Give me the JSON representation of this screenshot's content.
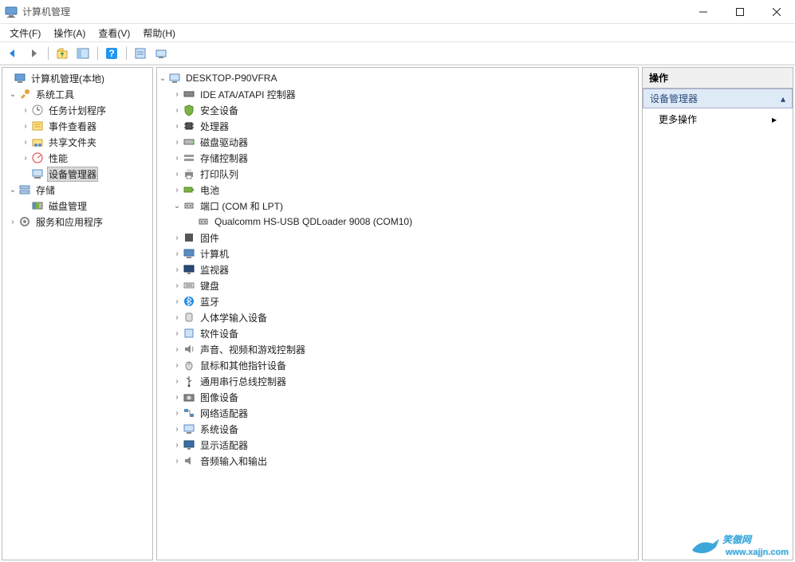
{
  "window": {
    "title": "计算机管理"
  },
  "menu": {
    "file": "文件(F)",
    "action": "操作(A)",
    "view": "查看(V)",
    "help": "帮助(H)"
  },
  "left_tree": {
    "root": "计算机管理(本地)",
    "system_tools": "系统工具",
    "task_scheduler": "任务计划程序",
    "event_viewer": "事件查看器",
    "shared_folders": "共享文件夹",
    "performance": "性能",
    "device_manager": "设备管理器",
    "storage": "存储",
    "disk_management": "磁盘管理",
    "services_apps": "服务和应用程序"
  },
  "center_tree": {
    "root": "DESKTOP-P90VFRA",
    "ide": "IDE ATA/ATAPI 控制器",
    "security": "安全设备",
    "cpu": "处理器",
    "disk_drives": "磁盘驱动器",
    "storage_ctrl": "存储控制器",
    "print_queue": "打印队列",
    "battery": "电池",
    "ports": "端口 (COM 和 LPT)",
    "port_item": "Qualcomm HS-USB QDLoader 9008 (COM10)",
    "firmware": "固件",
    "computer": "计算机",
    "monitor": "监视器",
    "keyboard": "键盘",
    "bluetooth": "蓝牙",
    "hid": "人体学输入设备",
    "software_dev": "软件设备",
    "sound": "声音、视频和游戏控制器",
    "mouse": "鼠标和其他指针设备",
    "usb": "通用串行总线控制器",
    "imaging": "图像设备",
    "network": "网络适配器",
    "system_dev": "系统设备",
    "display": "显示适配器",
    "audio_io": "音频输入和输出"
  },
  "actions": {
    "header": "操作",
    "section": "设备管理器",
    "more": "更多操作"
  },
  "watermark": {
    "brand": "笑傲网",
    "url": "www.xajjn.com"
  }
}
